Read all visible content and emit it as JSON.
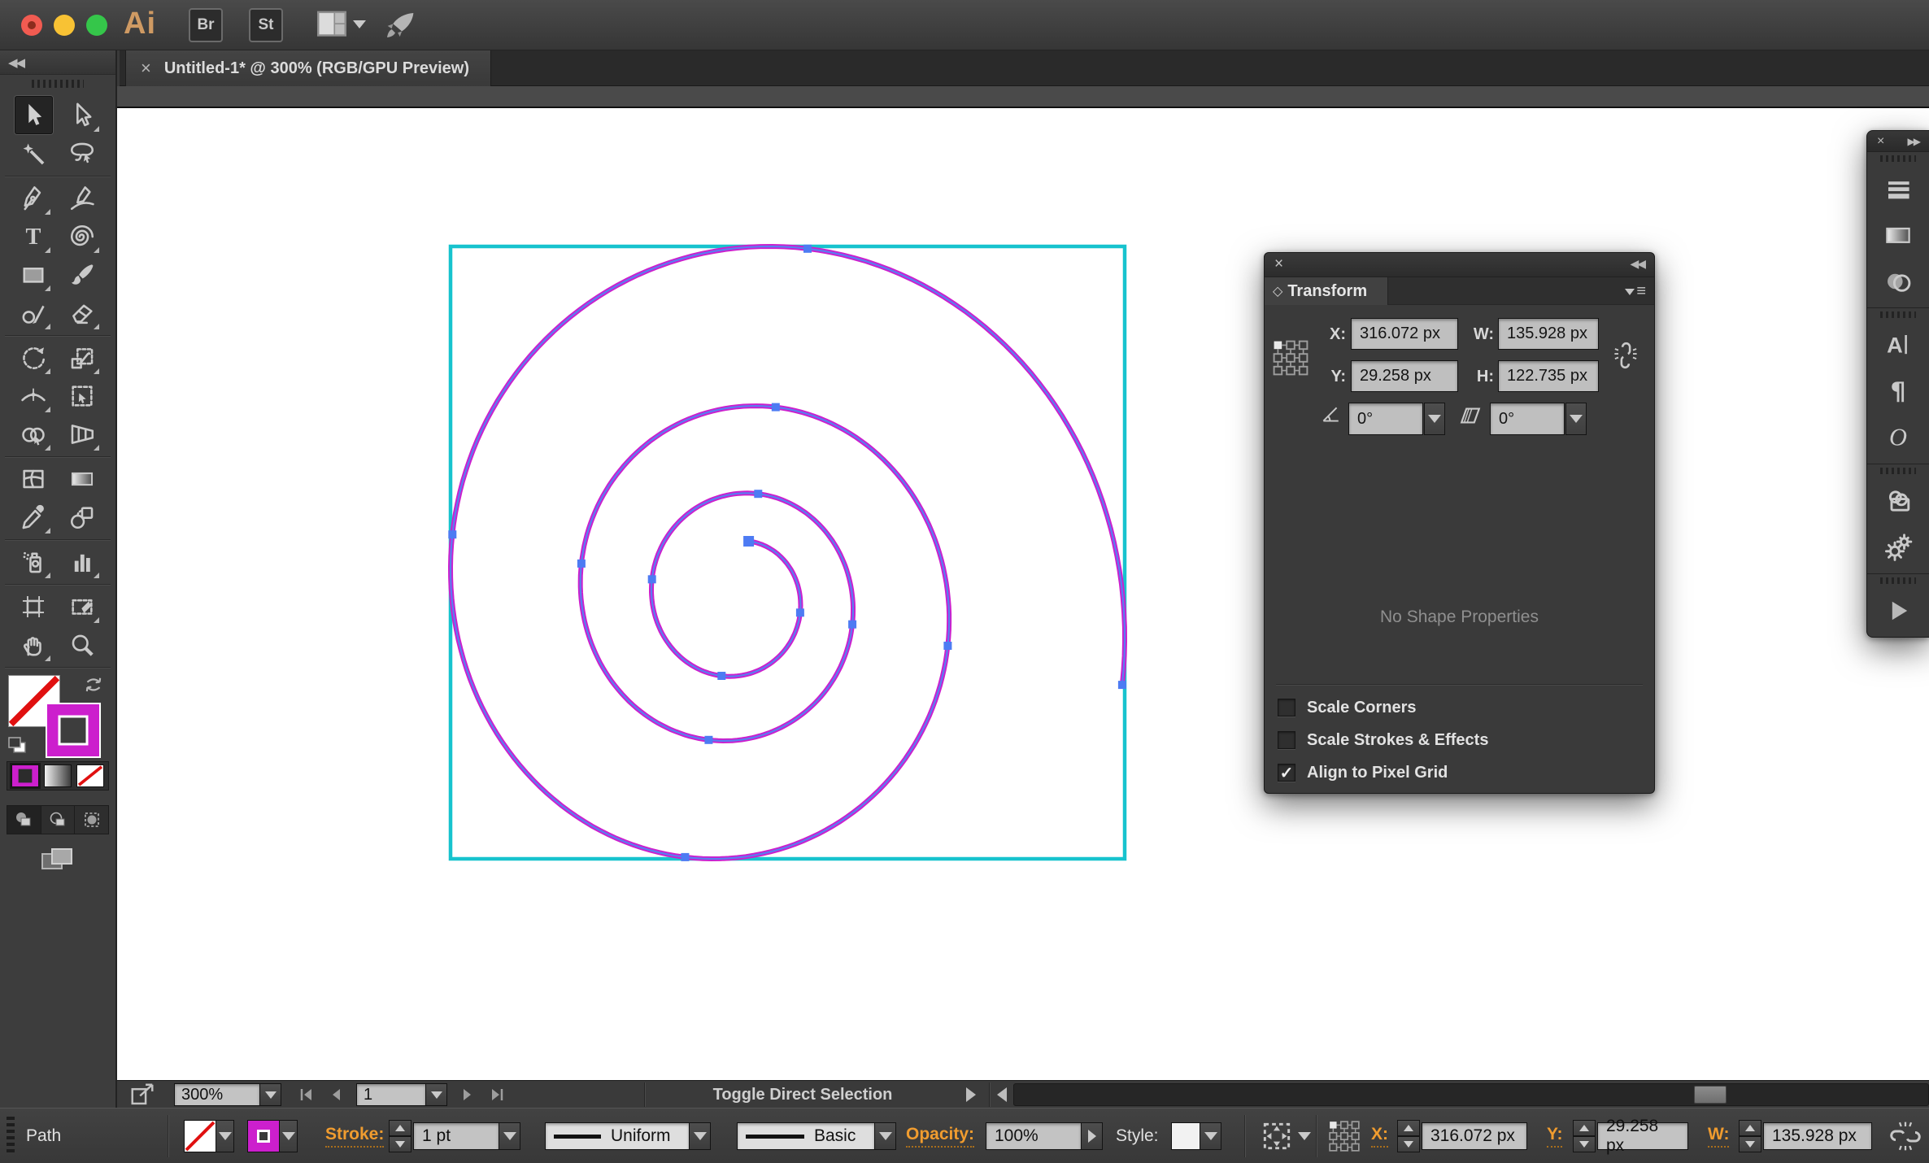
{
  "window": {
    "traffic_lights": [
      "close",
      "minimize",
      "zoom"
    ],
    "tab_title": "Untitled-1* @ 300% (RGB/GPU Preview)",
    "tab_close": "×"
  },
  "app_bar": {
    "logo": "Ai",
    "bridge_button": "Br",
    "stock_button": "St"
  },
  "toolbar": {
    "collapse_glyph": "◀◀",
    "rows": [
      [
        {
          "name": "selection",
          "selected": true,
          "flyout": false
        },
        {
          "name": "direct-selection",
          "flyout": true
        }
      ],
      [
        {
          "name": "magic-wand",
          "flyout": false
        },
        {
          "name": "lasso",
          "flyout": false
        }
      ],
      "div",
      [
        {
          "name": "pen",
          "flyout": true
        },
        {
          "name": "curvature",
          "flyout": false
        }
      ],
      [
        {
          "name": "type",
          "flyout": true
        },
        {
          "name": "line-spiral",
          "flyout": true
        }
      ],
      [
        {
          "name": "rectangle",
          "flyout": true
        },
        {
          "name": "paintbrush",
          "flyout": false
        }
      ],
      [
        {
          "name": "shaper",
          "flyout": true
        },
        {
          "name": "eraser",
          "flyout": true
        }
      ],
      "div",
      [
        {
          "name": "rotate",
          "flyout": true
        },
        {
          "name": "scale",
          "flyout": true
        }
      ],
      [
        {
          "name": "width",
          "flyout": true
        },
        {
          "name": "free-transform",
          "flyout": false
        }
      ],
      [
        {
          "name": "shape-builder",
          "flyout": true
        },
        {
          "name": "perspective-grid",
          "flyout": true
        }
      ],
      "div",
      [
        {
          "name": "mesh",
          "flyout": false
        },
        {
          "name": "gradient",
          "flyout": false
        }
      ],
      [
        {
          "name": "eyedropper",
          "flyout": true
        },
        {
          "name": "blend",
          "flyout": false
        }
      ],
      "div",
      [
        {
          "name": "symbol-sprayer",
          "flyout": true
        },
        {
          "name": "column-graph",
          "flyout": true
        }
      ],
      "div",
      [
        {
          "name": "artboard",
          "flyout": false
        },
        {
          "name": "slice",
          "flyout": true
        }
      ],
      [
        {
          "name": "hand",
          "flyout": true
        },
        {
          "name": "zoom",
          "flyout": false
        }
      ],
      "div"
    ]
  },
  "transform_panel": {
    "close": "×",
    "collapse_glyph": "◀◀",
    "title": "Transform",
    "title_diamond": "◇",
    "x_label": "X:",
    "x_value": "316.072 px",
    "y_label": "Y:",
    "y_value": "29.258 px",
    "w_label": "W:",
    "w_value": "135.928 px",
    "h_label": "H:",
    "h_value": "122.735 px",
    "rotate_value": "0°",
    "shear_value": "0°",
    "empty_text": "No Shape Properties",
    "checkboxes": [
      {
        "label": "Scale Corners",
        "checked": false
      },
      {
        "label": "Scale Strokes & Effects",
        "checked": false
      },
      {
        "label": "Align to Pixel Grid",
        "checked": true
      }
    ],
    "check_glyph": "✓"
  },
  "dock": {
    "close": "×",
    "expand_glyph": "▶▶",
    "groups": [
      [
        "stroke-panel",
        "gradient-panel",
        "transparency-panel"
      ],
      [
        "character-panel",
        "paragraph-panel",
        "opentype-panel"
      ],
      [
        "appearance-panel",
        "graphic-styles-panel"
      ],
      [
        "actions-panel"
      ]
    ]
  },
  "status_bar": {
    "zoom_level": "300%",
    "artboard_number": "1",
    "tool_hint": "Toggle Direct Selection"
  },
  "control_bar": {
    "selection_type": "Path",
    "stroke_label": "Stroke:",
    "stroke_weight": "1 pt",
    "width_profile": "Uniform",
    "brush_definition": "Basic",
    "opacity_label": "Opacity:",
    "opacity_value": "100%",
    "style_label": "Style:",
    "x_label": "X:",
    "x_value": "316.072 px",
    "y_label": "Y:",
    "y_value": "29.258 px",
    "w_label": "W:",
    "w_value": "135.928 px"
  },
  "colors": {
    "bounding_cyan": "#17c3ce",
    "path_magenta": "#cc1fcd",
    "selection_blue": "#5b7cf1",
    "anchor_blue": "#4d7bf3",
    "accent_orange": "#f09c2f"
  }
}
